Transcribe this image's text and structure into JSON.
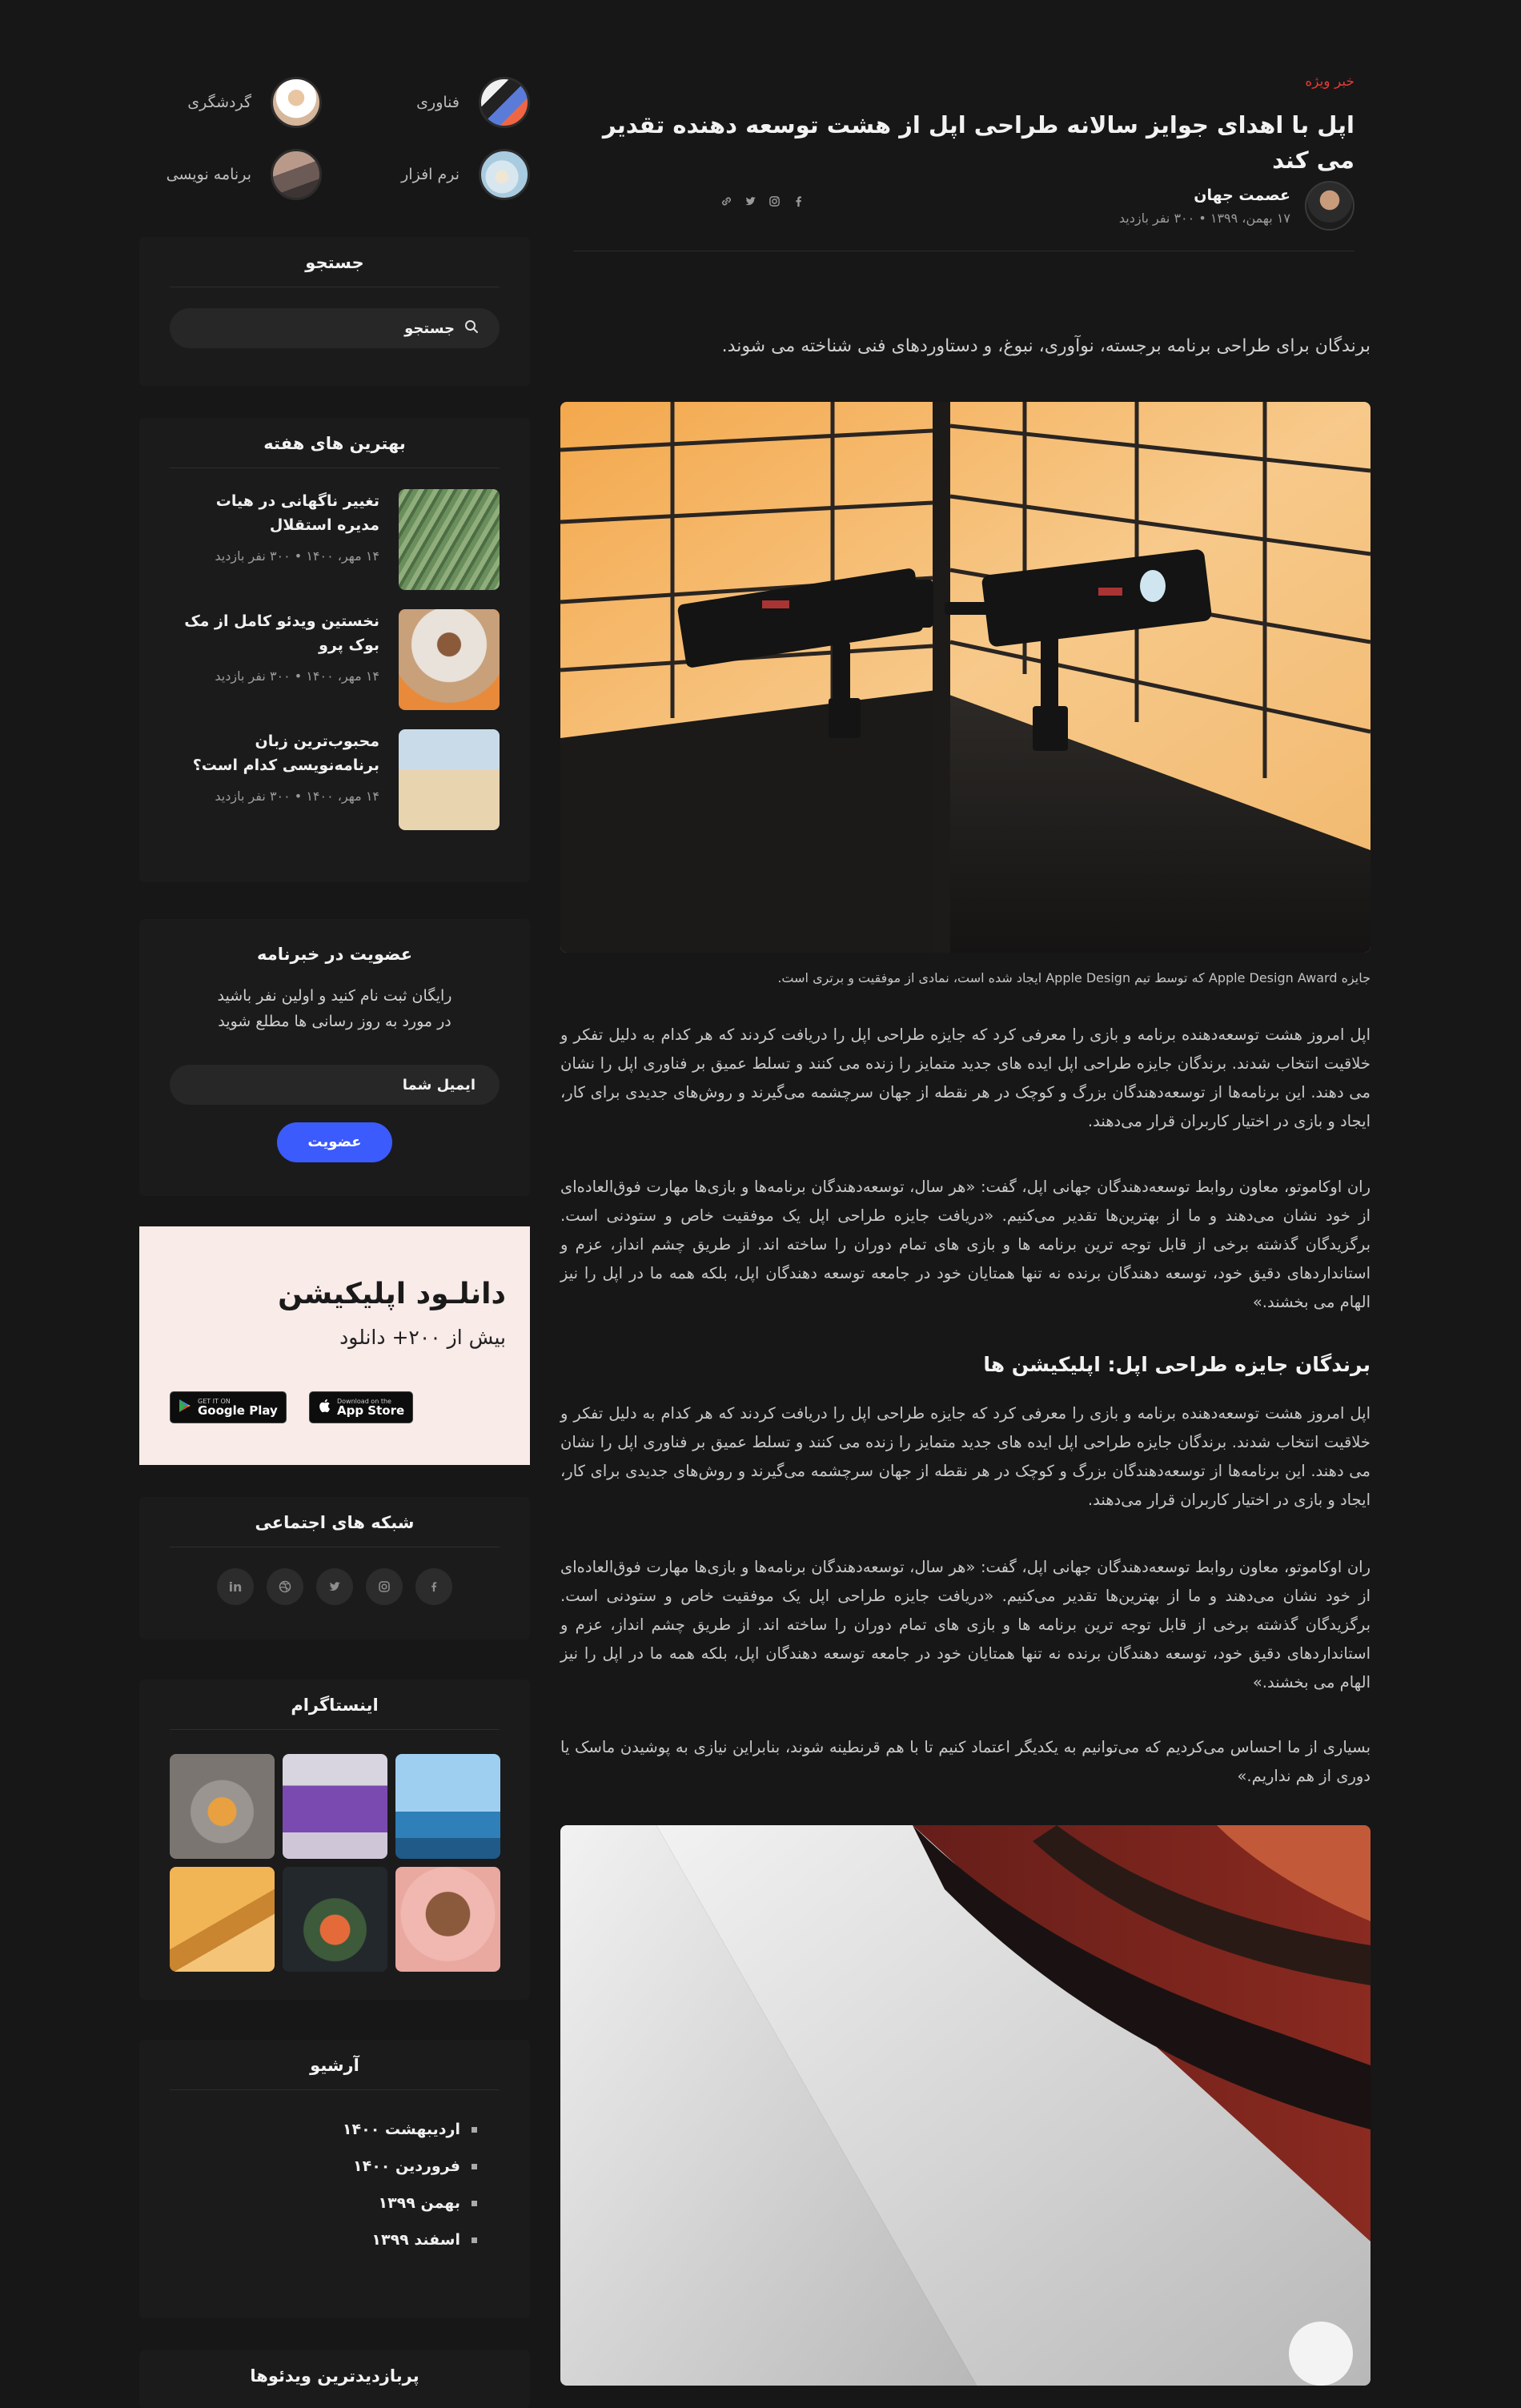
{
  "article": {
    "kicker": "خبر ویژه",
    "title": "اپل با اهدای جوایز سالانه طراحی اپل از هشت توسعه دهنده تقدیر می کند",
    "author_name": "عصمت جهان",
    "author_meta": "۱۷ بهمن، ۱۳۹۹ • ۳۰۰ نفر بازدید",
    "share_icons": [
      "facebook-icon",
      "instagram-icon",
      "twitter-icon",
      "link-icon"
    ],
    "lead": "برندگان برای طراحی برنامه برجسته، نوآوری، نبوغ، و دستاوردهای فنی شناخته می شوند.",
    "caption": "جایزه Apple Design Award که توسط تیم Apple Design ایجاد شده است، نمادی از موفقیت و برتری است.",
    "paragraph_1": "اپل امروز هشت توسعه‌دهنده برنامه و بازی را معرفی کرد که جایزه طراحی اپل را دریافت کردند که هر کدام به دلیل تفکر و خلاقیت انتخاب شدند. برندگان جایزه طراحی اپل ایده های جدید متمایز را زنده می کنند و تسلط عمیق بر فناوری اپل را نشان می دهند. این برنامه‌ها از توسعه‌دهندگان بزرگ و کوچک در هر نقطه از جهان سرچشمه می‌گیرند و روش‌های جدیدی برای کار، ایجاد و بازی در اختیار کاربران قرار می‌دهند.",
    "paragraph_2": "ران اوکاموتو، معاون روابط توسعه‌دهندگان جهانی اپل، گفت: «هر سال، توسعه‌دهندگان برنامه‌ها و بازی‌ها مهارت فوق‌العاده‌ای از خود نشان می‌دهند و ما از بهترین‌ها تقدیر می‌کنیم. «دریافت جایزه طراحی اپل یک موفقیت خاص و ستودنی است. برگزیدگان گذشته برخی از قابل توجه ترین برنامه ها و بازی های تمام دوران را ساخته اند. از طریق چشم انداز، عزم و استانداردهای دقیق خود، توسعه دهندگان برنده نه تنها همتایان خود در جامعه توسعه دهندگان اپل، بلکه همه ما در اپل را نیز الهام می بخشند.»",
    "subheading": "برندگان جایزه طراحی اپل: اپلیکیشن ها",
    "paragraph_3": "اپل امروز هشت توسعه‌دهنده برنامه و بازی را معرفی کرد که جایزه طراحی اپل را دریافت کردند که هر کدام به دلیل تفکر و خلاقیت انتخاب شدند. برندگان جایزه طراحی اپل ایده های جدید متمایز را زنده می کنند و تسلط عمیق بر فناوری اپل را نشان می دهند. این برنامه‌ها از توسعه‌دهندگان بزرگ و کوچک در هر نقطه از جهان سرچشمه می‌گیرند و روش‌های جدیدی برای کار، ایجاد و بازی در اختیار کاربران قرار می‌دهند.",
    "paragraph_4": "ران اوکاموتو، معاون روابط توسعه‌دهندگان جهانی اپل، گفت: «هر سال، توسعه‌دهندگان برنامه‌ها و بازی‌ها مهارت فوق‌العاده‌ای از خود نشان می‌دهند و ما از بهترین‌ها تقدیر می‌کنیم. «دریافت جایزه طراحی اپل یک موفقیت خاص و ستودنی است. برگزیدگان گذشته برخی از قابل توجه ترین برنامه ها و بازی های تمام دوران را ساخته اند. از طریق چشم انداز، عزم و استانداردهای دقیق خود، توسعه دهندگان برنده نه تنها همتایان خود در جامعه توسعه دهندگان اپل، بلکه همه ما در اپل را نیز الهام می بخشند.»",
    "paragraph_5": "بسیاری از ما احساس می‌کردیم که می‌توانیم به یکدیگر اعتماد کنیم تا با هم قرنطینه شوند، بنابراین نیازی به پوشیدن ماسک یا دوری از هم نداریم.»"
  },
  "sidebar": {
    "categories": [
      {
        "label": "فناوری"
      },
      {
        "label": "گردشگری"
      },
      {
        "label": "نرم افزار"
      },
      {
        "label": "برنامه نویسی"
      }
    ],
    "search": {
      "title": "جستجو",
      "label": "جستجو"
    },
    "best_week": {
      "title": "بهترین های هفته",
      "posts": [
        {
          "title": "تغییر ناگهانی در هیات مدیره استقلال",
          "meta": "۱۴ مهر، ۱۴۰۰ • ۳۰۰ نفر بازدید"
        },
        {
          "title": "نخستین ویدئو کامل از مک بوک پرو",
          "meta": "۱۴ مهر، ۱۴۰۰ • ۳۰۰ نفر بازدید"
        },
        {
          "title": "محبوب‌ترین زبان برنامه‌نویسی کدام است؟",
          "meta": "۱۴ مهر، ۱۴۰۰ • ۳۰۰ نفر بازدید"
        }
      ]
    },
    "newsletter": {
      "title": "عضویت در خبرنامه",
      "text_line_1": "رایگان ثبت نام کنید و اولین نفر باشید",
      "text_line_2": "در مورد به روز رسانی ها مطلع شوید",
      "input_label": "ایمیل شما",
      "button": "عضویت"
    },
    "app": {
      "title": "دانلـود اپلیکیشن",
      "subtitle": "بیش از ۲۰۰+ دانلود",
      "google_small": "GET IT ON",
      "google_big": "Google Play",
      "apple_small": "Download on the",
      "apple_big": "App Store"
    },
    "social": {
      "title": "شبکه های اجتماعی",
      "icons": [
        "facebook-icon",
        "instagram-icon",
        "twitter-icon",
        "dribbble-icon",
        "linkedin-icon"
      ]
    },
    "instagram": {
      "title": "اینستاگرام"
    },
    "archive": {
      "title": "آرشیو",
      "items": [
        "اردیبهشت ۱۴۰۰",
        "فروردین ۱۴۰۰",
        "بهمن ۱۳۹۹",
        "اسفند ۱۳۹۹"
      ]
    },
    "videos": {
      "title": "پربازدیدترین ویدئوها"
    }
  },
  "colors": {
    "background": "#171717",
    "card": "#1b1b1b",
    "accent_red": "#e53935",
    "accent_blue": "#3b5bfd",
    "app_card": "#f8ebe8"
  }
}
